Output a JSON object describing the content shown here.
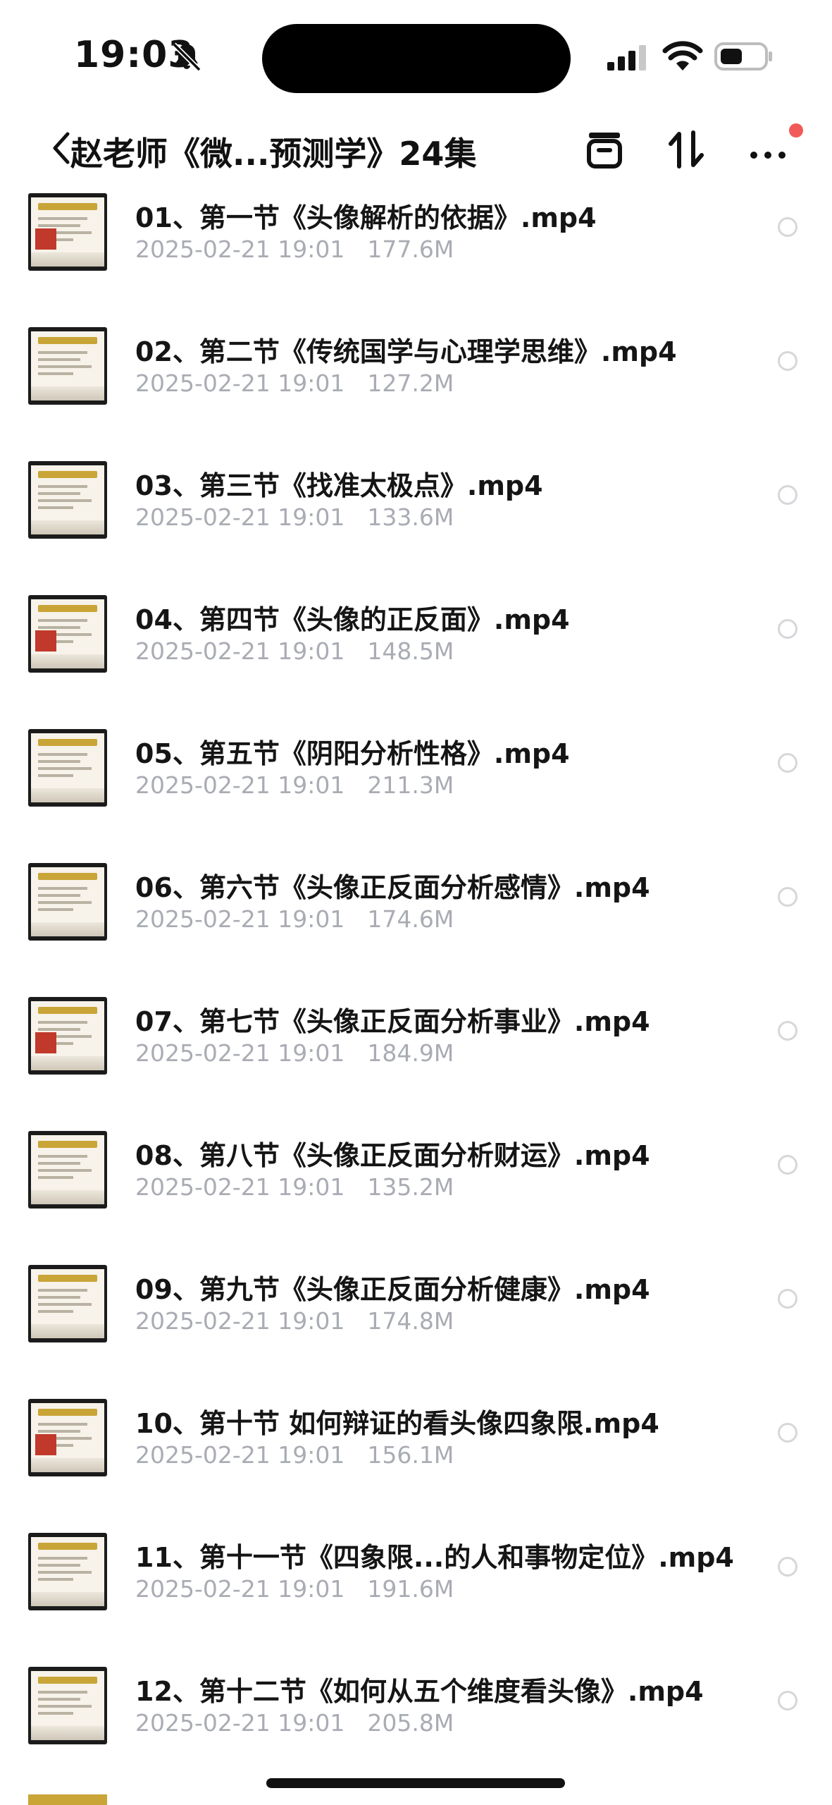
{
  "status_bar": {
    "time": "19:03",
    "icons": [
      "bell-slash-icon",
      "cellular-signal-icon",
      "wifi-icon",
      "battery-icon"
    ]
  },
  "nav": {
    "back_icon": "chevron-left-icon",
    "title": "赵老师《微...预测学》24集",
    "actions": [
      "save-box-icon",
      "sort-icon",
      "more-icon"
    ],
    "badge_color": "#f25a5a"
  },
  "files": [
    {
      "name": "01、第一节《头像解析的依据》.mp4",
      "date": "2025-02-21 19:01",
      "size": "177.6M"
    },
    {
      "name": "02、第二节《传统国学与心理学思维》.mp4",
      "date": "2025-02-21 19:01",
      "size": "127.2M"
    },
    {
      "name": "03、第三节《找准太极点》.mp4",
      "date": "2025-02-21 19:01",
      "size": "133.6M"
    },
    {
      "name": "04、第四节《头像的正反面》.mp4",
      "date": "2025-02-21 19:01",
      "size": "148.5M"
    },
    {
      "name": "05、第五节《阴阳分析性格》.mp4",
      "date": "2025-02-21 19:01",
      "size": "211.3M"
    },
    {
      "name": "06、第六节《头像正反面分析感情》.mp4",
      "date": "2025-02-21 19:01",
      "size": "174.6M"
    },
    {
      "name": "07、第七节《头像正反面分析事业》.mp4",
      "date": "2025-02-21 19:01",
      "size": "184.9M"
    },
    {
      "name": "08、第八节《头像正反面分析财运》.mp4",
      "date": "2025-02-21 19:01",
      "size": "135.2M"
    },
    {
      "name": "09、第九节《头像正反面分析健康》.mp4",
      "date": "2025-02-21 19:01",
      "size": "174.8M"
    },
    {
      "name": "10、第十节 如何辩证的看头像四象限.mp4",
      "date": "2025-02-21 19:01",
      "size": "156.1M"
    },
    {
      "name": "11、第十一节《四象限...的人和事物定位》.mp4",
      "date": "2025-02-21 19:01",
      "size": "191.6M"
    },
    {
      "name": "12、第十二节《如何从五个维度看头像》.mp4",
      "date": "2025-02-21 19:01",
      "size": "205.8M"
    }
  ]
}
